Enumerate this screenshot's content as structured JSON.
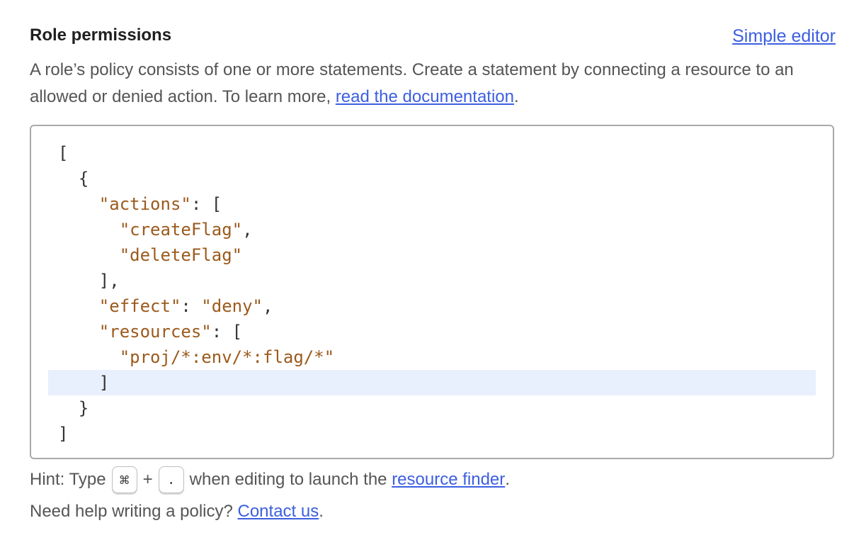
{
  "header": {
    "title": "Role permissions",
    "simple_editor_label": "Simple editor"
  },
  "description": {
    "text": "A role’s policy consists of one or more statements. Create a statement by connecting a resource to an allowed or denied action. To learn more, ",
    "link_label": "read the documentation",
    "suffix": "."
  },
  "editor": {
    "lines": [
      [
        {
          "t": "["
        }
      ],
      [
        {
          "t": "  {"
        }
      ],
      [
        {
          "t": "    "
        },
        {
          "t": "\"actions\"",
          "s": true
        },
        {
          "t": ": ["
        }
      ],
      [
        {
          "t": "      "
        },
        {
          "t": "\"createFlag\"",
          "s": true
        },
        {
          "t": ","
        }
      ],
      [
        {
          "t": "      "
        },
        {
          "t": "\"deleteFlag\"",
          "s": true
        }
      ],
      [
        {
          "t": "    ],"
        }
      ],
      [
        {
          "t": "    "
        },
        {
          "t": "\"effect\"",
          "s": true
        },
        {
          "t": ": "
        },
        {
          "t": "\"deny\"",
          "s": true
        },
        {
          "t": ","
        }
      ],
      [
        {
          "t": "    "
        },
        {
          "t": "\"resources\"",
          "s": true
        },
        {
          "t": ": ["
        }
      ],
      [
        {
          "t": "      "
        },
        {
          "t": "\"proj/*:env/*:flag/*\"",
          "s": true
        }
      ],
      [
        {
          "t": "    ]"
        }
      ],
      [
        {
          "t": "  }"
        }
      ],
      [
        {
          "t": "]"
        }
      ]
    ],
    "active_line": 9
  },
  "hint": {
    "prefix": "Hint: Type",
    "key1": "⌘",
    "plus": "+",
    "key2": ".",
    "middle": "when editing to launch the",
    "link_label": "resource finder",
    "suffix": "."
  },
  "help": {
    "text": "Need help writing a policy? ",
    "link_label": "Contact us",
    "suffix": "."
  }
}
